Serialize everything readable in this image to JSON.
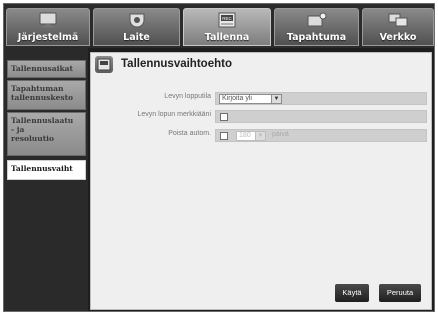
{
  "tabs": [
    {
      "label": "Järjestelmä",
      "icon": "monitor-icon"
    },
    {
      "label": "Laite",
      "icon": "camera-icon"
    },
    {
      "label": "Tallenna",
      "icon": "record-icon"
    },
    {
      "label": "Tapahtuma",
      "icon": "event-icon"
    },
    {
      "label": "Verkko",
      "icon": "network-icon"
    }
  ],
  "sidebar": {
    "items": [
      {
        "label": "Tallennusaikat"
      },
      {
        "label": "Tapahtuman\ntallennuskesto"
      },
      {
        "label": "Tallennuslaatu\n- ja\nresoluutio"
      },
      {
        "label": "Tallennusvaiht"
      }
    ]
  },
  "panel": {
    "title": "Tallennusvaihtoehto",
    "rows": [
      {
        "label": "Levyn lopputila",
        "select_value": "Kirjoita yli"
      },
      {
        "label": "Levyn lopun merkkiääni"
      },
      {
        "label": "Poista autom.",
        "select_value": "180",
        "unit": "päivä"
      }
    ]
  },
  "buttons": {
    "apply": "Käytä",
    "cancel": "Peruuta"
  }
}
